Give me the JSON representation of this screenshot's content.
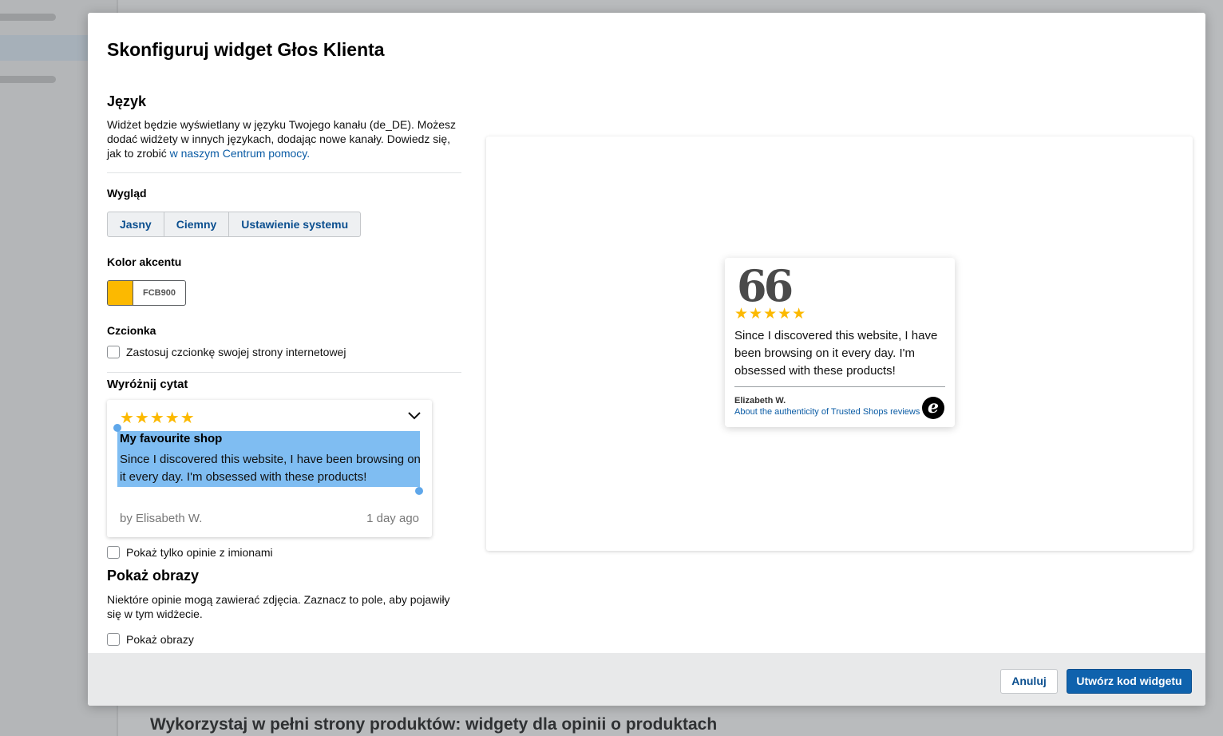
{
  "background": {
    "bottom_heading": "Wykorzystaj w pełni strony produktów: widgety dla opinii o produktach"
  },
  "modal": {
    "title": "Skonfiguruj widget Głos Klienta",
    "language": {
      "heading": "Język",
      "text_before_link": "Widżet będzie wyświetlany w języku Twojego kanału (de_DE). Możesz dodać widżety w innych językach, dodając nowe kanały. Dowiedz się, jak to zrobić ",
      "link": "w naszym Centrum pomocy."
    },
    "appearance": {
      "heading": "Wygląd",
      "options": [
        "Jasny",
        "Ciemny",
        "Ustawienie systemu"
      ]
    },
    "accent": {
      "heading": "Kolor akcentu",
      "hex": "FCB900",
      "color": "#FCB900"
    },
    "font": {
      "heading": "Czcionka",
      "checkbox_label": "Zastosuj czcionkę swojej strony internetowej"
    },
    "highlight": {
      "heading": "Wyróżnij cytat",
      "stars": "★★★★★",
      "review_title": "My favourite shop",
      "review_body": "Since I discovered this website, I have been browsing on it every day. I'm obsessed with these products!",
      "author": "by Elisabeth W.",
      "date": "1 day ago",
      "names_only_label": "Pokaż tylko opinie z imionami"
    },
    "images": {
      "heading": "Pokaż obrazy",
      "text": "Niektóre opinie mogą zawierać zdjęcia. Zaznacz to pole, aby pojawiły się w tym widżecie.",
      "checkbox_label": "Pokaż obrazy"
    },
    "preview": {
      "quote_mark": "66",
      "stars": "★★★★★",
      "text": "Since I discovered this website, I have been browsing on it every day. I'm obsessed with these products!",
      "author": "Elizabeth W.",
      "link": "About the authenticity of Trusted Shops reviews",
      "badge": "e"
    },
    "footer": {
      "cancel": "Anuluj",
      "create": "Utwórz kod widgetu"
    }
  }
}
